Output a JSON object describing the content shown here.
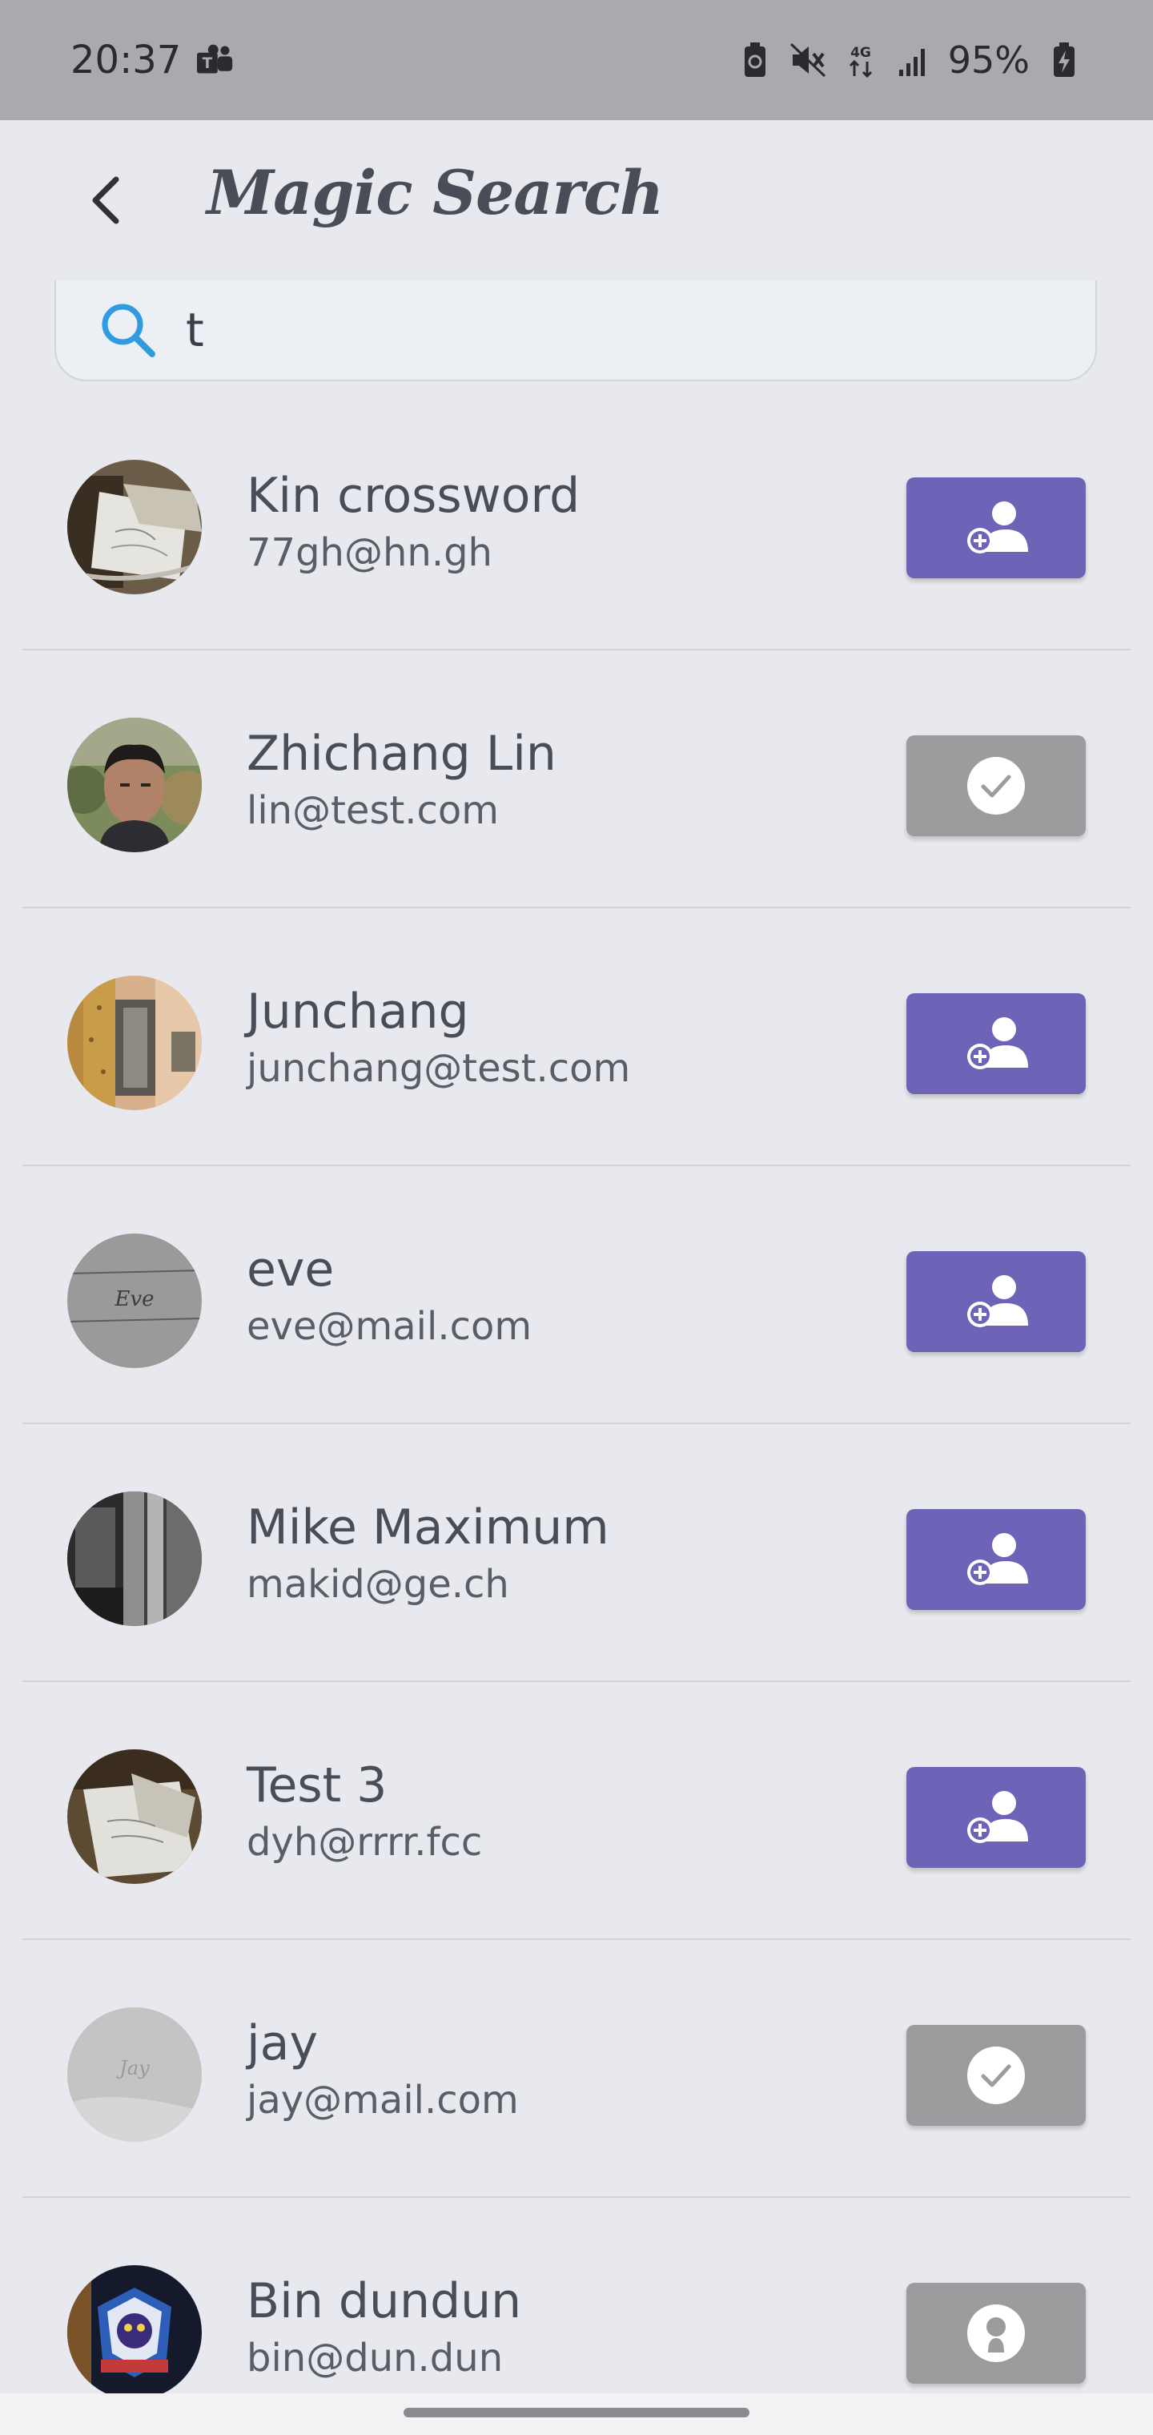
{
  "status_bar": {
    "time": "20:37",
    "battery": "95%",
    "icons": [
      "teams-icon",
      "battery-saver-icon",
      "mute-icon",
      "4g-icon",
      "signal-icon",
      "battery-charging-icon"
    ]
  },
  "header": {
    "title": "Magic Search",
    "back_icon": "chevron-left-icon"
  },
  "search": {
    "value": "t",
    "icon": "search-icon"
  },
  "colors": {
    "accent": "#6d64b8",
    "added": "#9c9c9f",
    "background": "#e8e9ee",
    "status_bar": "#a9aaae",
    "search_icon": "#2f9be0"
  },
  "users": [
    {
      "name": "Kin crossword",
      "email": "77gh@hn.gh",
      "action": "add",
      "action_icon": "person-add-icon"
    },
    {
      "name": "Zhichang Lin",
      "email": "lin@test.com",
      "action": "added",
      "action_icon": "check-icon"
    },
    {
      "name": "Junchang",
      "email": "junchang@test.com",
      "action": "add",
      "action_icon": "person-add-icon"
    },
    {
      "name": "eve",
      "email": "eve@mail.com",
      "action": "add",
      "action_icon": "person-add-icon"
    },
    {
      "name": "Mike Maximum",
      "email": "makid@ge.ch",
      "action": "add",
      "action_icon": "person-add-icon"
    },
    {
      "name": "Test 3",
      "email": "dyh@rrrr.fcc",
      "action": "add",
      "action_icon": "person-add-icon"
    },
    {
      "name": "jay",
      "email": "jay@mail.com",
      "action": "added",
      "action_icon": "check-icon"
    },
    {
      "name": "Bin dundun",
      "email": "bin@dun.dun",
      "action": "self",
      "action_icon": "person-icon"
    }
  ]
}
